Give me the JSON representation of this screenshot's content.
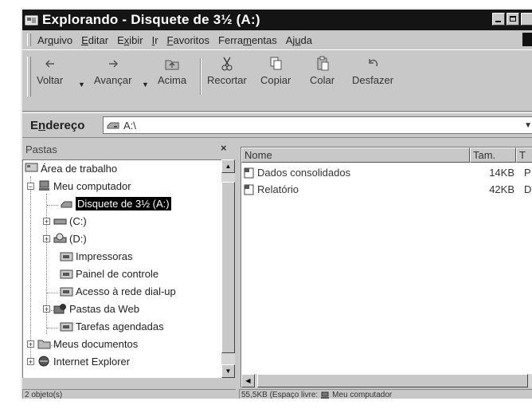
{
  "window": {
    "title": "Explorando - Disquete de 3½ (A:)"
  },
  "menu": {
    "items": [
      {
        "pre": "Ar",
        "u": "q",
        "post": "uivo"
      },
      {
        "pre": "",
        "u": "E",
        "post": "ditar"
      },
      {
        "pre": "E",
        "u": "x",
        "post": "ibir"
      },
      {
        "pre": "",
        "u": "I",
        "post": "r"
      },
      {
        "pre": "",
        "u": "F",
        "post": "avoritos"
      },
      {
        "pre": "Ferra",
        "u": "m",
        "post": "entas"
      },
      {
        "pre": "Aj",
        "u": "u",
        "post": "da"
      }
    ]
  },
  "toolbar": {
    "back": "Voltar",
    "forward": "Avançar",
    "up": "Acima",
    "cut": "Recortar",
    "copy": "Copiar",
    "paste": "Colar",
    "undo": "Desfazer"
  },
  "address": {
    "label_pre": "E",
    "label_u": "n",
    "label_post": "dereço",
    "value": "A:\\"
  },
  "folders": {
    "header": "Pastas",
    "close": "×",
    "tree": [
      {
        "label": "Área de trabalho"
      },
      {
        "label": "Meu computador",
        "exp": "−"
      },
      {
        "label": "Disquete de 3½ (A:)",
        "selected": true
      },
      {
        "label": "(C:)",
        "exp": "+"
      },
      {
        "label": "(D:)",
        "exp": "+"
      },
      {
        "label": "Impressoras"
      },
      {
        "label": "Painel de controle"
      },
      {
        "label": "Acesso à rede dial-up"
      },
      {
        "label": "Pastas da Web",
        "exp": "+"
      },
      {
        "label": "Tarefas agendadas"
      },
      {
        "label": "Meus documentos",
        "exp": "+"
      },
      {
        "label": "Internet Explorer",
        "exp": "+"
      }
    ]
  },
  "files": {
    "columns": {
      "name": "Nome",
      "size": "Tam.",
      "type": "T"
    },
    "rows": [
      {
        "name": "Dados consolidados",
        "size": "14KB",
        "type": "P"
      },
      {
        "name": "Relatório",
        "size": "42KB",
        "type": "D"
      }
    ]
  },
  "status": {
    "count": "2 objeto(s)",
    "space": "55,5KB (Espaço livre:",
    "location": "Meu computador"
  }
}
